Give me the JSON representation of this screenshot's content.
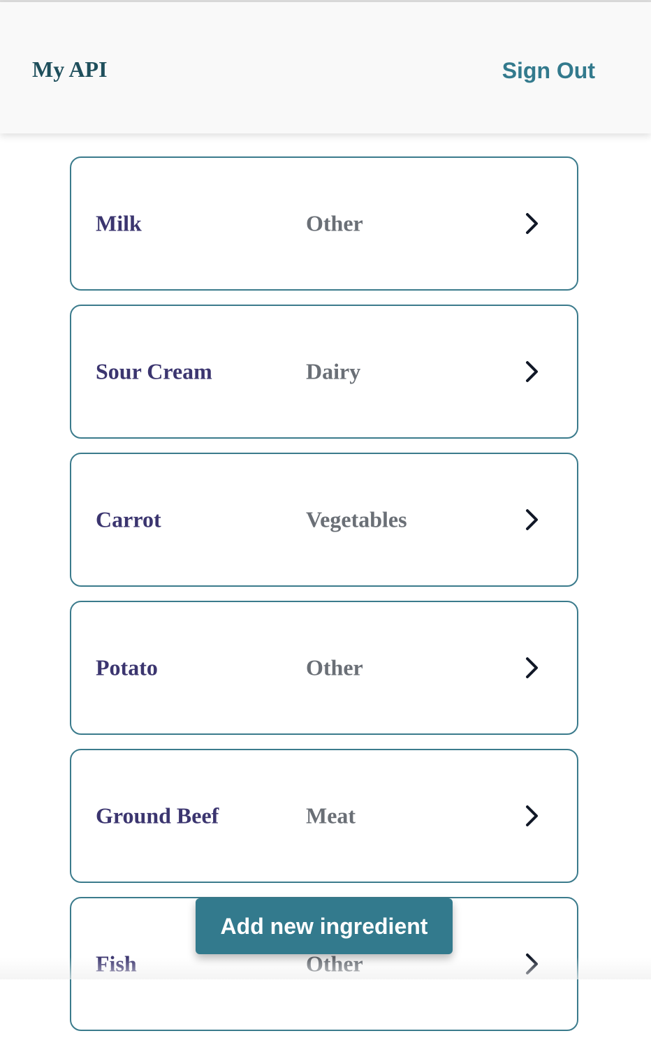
{
  "header": {
    "title": "My API",
    "sign_out_label": "Sign Out"
  },
  "ingredients": [
    {
      "name": "Milk",
      "category": "Other"
    },
    {
      "name": "Sour Cream",
      "category": "Dairy"
    },
    {
      "name": "Carrot",
      "category": "Vegetables"
    },
    {
      "name": "Potato",
      "category": "Other"
    },
    {
      "name": "Ground Beef",
      "category": "Meat"
    },
    {
      "name": "Fish",
      "category": "Other"
    }
  ],
  "add_button_label": "Add new ingredient",
  "icons": {
    "row_action": "chevron-right-icon"
  },
  "colors": {
    "accent": "#337a8d",
    "card_border": "#3b7b8c",
    "name_text": "#3b356f",
    "category_text": "#6a6f76",
    "title_text": "#1f4f5c"
  }
}
